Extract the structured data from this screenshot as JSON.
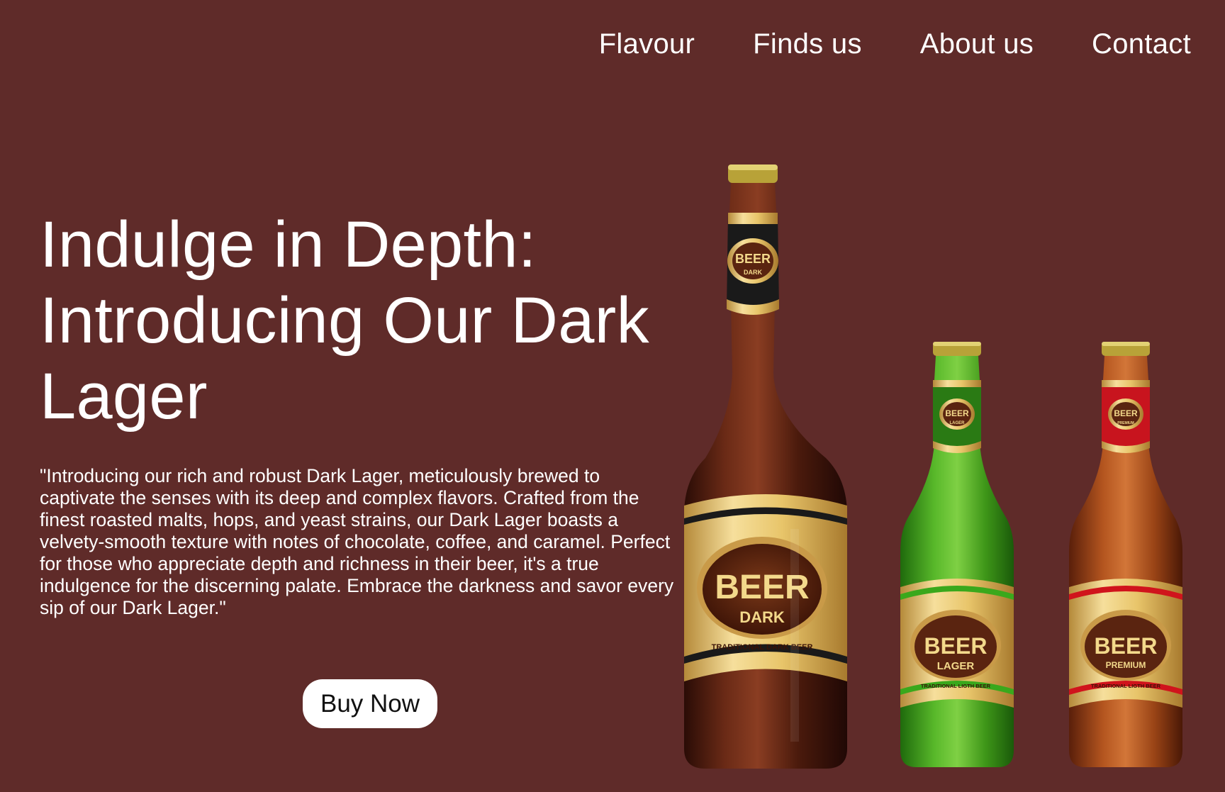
{
  "nav": {
    "items": [
      {
        "label": "Flavour"
      },
      {
        "label": "Finds us"
      },
      {
        "label": "About us"
      },
      {
        "label": "Contact"
      }
    ]
  },
  "hero": {
    "title": "Indulge in Depth: Introducing Our Dark Lager",
    "description": "\"Introducing our rich and robust Dark Lager, meticulously brewed to captivate the senses with its deep and complex flavors. Crafted from the finest roasted malts, hops, and yeast strains, our Dark Lager boasts a velvety-smooth texture with notes of chocolate, coffee, and caramel. Perfect for those who appreciate depth and richness in their beer, it's a true indulgence for the discerning palate. Embrace the darkness and savor every sip of our Dark Lager.\"",
    "cta_label": "Buy Now"
  },
  "bottles": [
    {
      "brand": "BEER",
      "variant": "DARK",
      "tagline": "TRADITIONAL DARK BEER",
      "color": "#4a1f12"
    },
    {
      "brand": "BEER",
      "variant": "LAGER",
      "tagline": "TRADITIONAL LIGTH BEER",
      "color": "#3f9a1c"
    },
    {
      "brand": "BEER",
      "variant": "PREMIUM",
      "tagline": "TRADITIONAL LIGTH BEER",
      "color": "#8a3a1a"
    }
  ],
  "colors": {
    "background": "#5f2b29",
    "text": "#ffffff",
    "button_bg": "#ffffff",
    "label_gold": "#e8c56a"
  }
}
